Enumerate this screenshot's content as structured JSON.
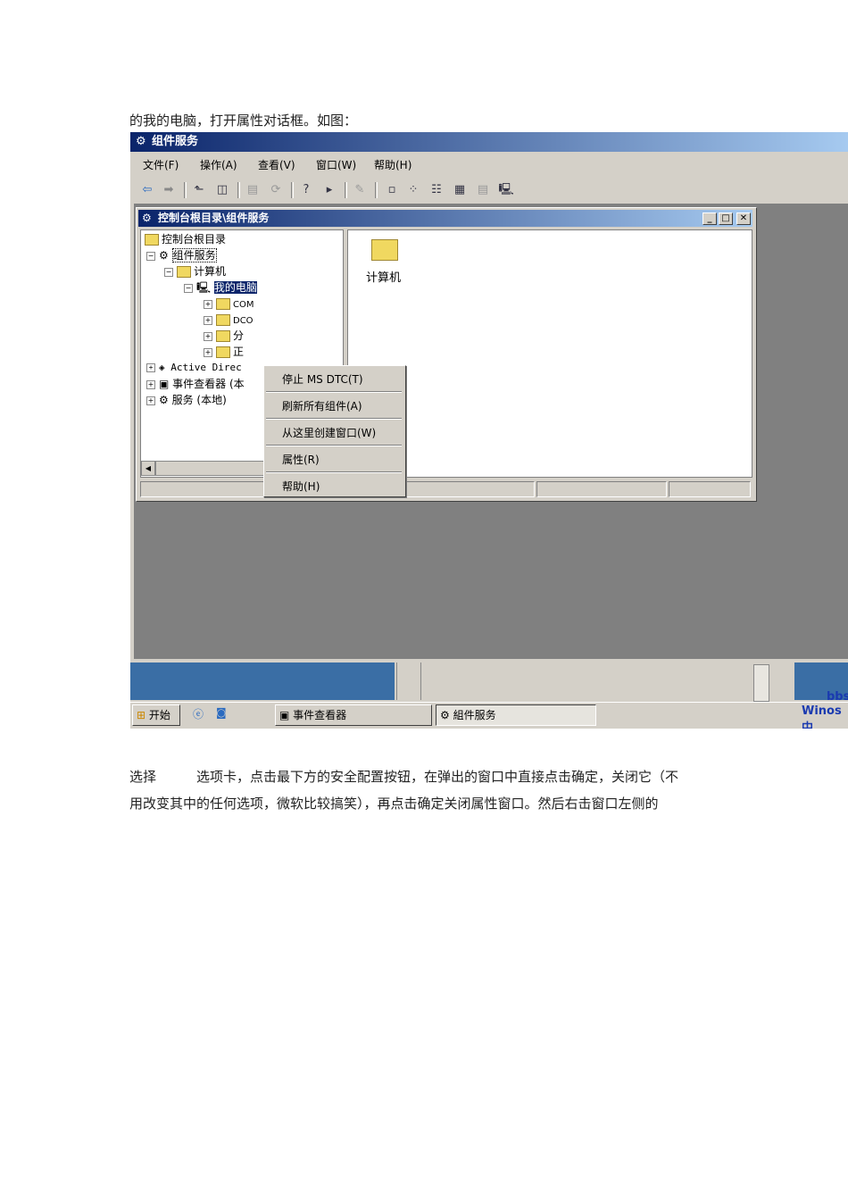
{
  "intro_text": "的我的电脑，打开属性对话框。如图：",
  "window": {
    "title": "组件服务",
    "menu": [
      "文件(F)",
      "操作(A)",
      "查看(V)",
      "窗口(W)",
      "帮助(H)"
    ],
    "inner_title": "控制台根目录\\组件服务",
    "tree": {
      "root": "控制台根目录",
      "component_services": "组件服务",
      "computers": "计算机",
      "my_computer": "我的电脑",
      "children": [
        "COM",
        "DCO",
        "分",
        "正"
      ],
      "active_directory": "Active Direc",
      "event_viewer": "事件查看器 (本",
      "services": "服务 (本地)"
    },
    "right_item": "计算机",
    "context_menu": [
      "停止 MS DTC(T)",
      "刷新所有组件(A)",
      "从这里创建窗口(W)",
      "属性(R)",
      "帮助(H)"
    ]
  },
  "taskbar": {
    "start": "开始",
    "buttons": [
      "事件查看器",
      "組件服务"
    ],
    "watermark_1": "bbs",
    "watermark_2": "Winos中"
  },
  "body_text": [
    "选择　　　选项卡，点击最下方的安全配置按钮，在弹出的窗口中直接点击确定，关闭它（不",
    "用改变其中的任何选项，微软比较搞笑），再点击确定关闭属性窗口。然后右击窗口左侧的"
  ]
}
